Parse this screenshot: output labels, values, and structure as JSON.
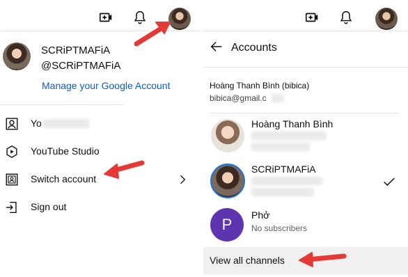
{
  "left": {
    "account": {
      "name": "SCRiPTMAFiA",
      "handle": "@SCRiPTMAFiA",
      "manage_link": "Manage your Google Account"
    },
    "menu_items": [
      {
        "label": "Yo",
        "icon": "person-icon"
      },
      {
        "label": "YouTube Studio",
        "icon": "youtube-studio-icon"
      },
      {
        "label": "Switch account",
        "icon": "switch-account-icon"
      },
      {
        "label": "Sign out",
        "icon": "sign-out-icon"
      }
    ]
  },
  "right": {
    "header_title": "Accounts",
    "owner": {
      "name": "Hoàng Thanh Bình (bibica)",
      "email": "bibica@gmail.c"
    },
    "channels": [
      {
        "name": "Hoàng Thanh Bình",
        "subtitle": ""
      },
      {
        "name": "SCRiPTMAFiA",
        "subtitle": "",
        "selected": true
      },
      {
        "name": "Phở",
        "subtitle": "No subscribers",
        "initial": "P"
      }
    ],
    "view_all": "View all channels"
  },
  "colors": {
    "link": "#065fd4",
    "arrow": "#e53935",
    "avatar_purple": "#5e35b1",
    "selected_ring": "#1a73e8"
  }
}
